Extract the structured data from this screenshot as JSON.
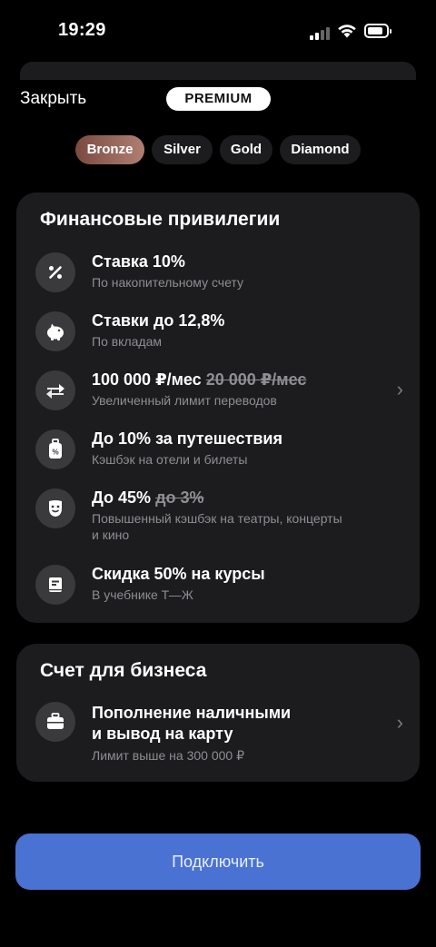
{
  "status": {
    "time": "19:29"
  },
  "header": {
    "close_label": "Закрыть",
    "badge": "PREMIUM"
  },
  "tiers": [
    "Bronze",
    "Silver",
    "Gold",
    "Diamond"
  ],
  "selected_tier": "Bronze",
  "financial": {
    "title": "Финансовые привилегии",
    "items": [
      {
        "title": "Ставка 10%",
        "subtitle": "По накопительному счету",
        "icon": "percent-icon"
      },
      {
        "title": "Ставки до 12,8%",
        "subtitle": "По вкладам",
        "icon": "piggy-bank-icon"
      },
      {
        "title": "100 000 ₽/мес",
        "strike": "20 000 ₽/мес",
        "subtitle": "Увеличенный лимит переводов",
        "icon": "transfer-arrows-icon"
      },
      {
        "title": "До 10% за путешествия",
        "subtitle": "Кэшбэк на отели и билеты",
        "icon": "luggage-icon"
      },
      {
        "title": "До 45%",
        "strike": "до 3%",
        "subtitle": "Повышенный кэшбэк на театры, концерты",
        "subtitle2": "и кино",
        "icon": "theater-mask-icon"
      },
      {
        "title": "Скидка 50% на курсы",
        "subtitle": "В учебнике Т—Ж",
        "icon": "book-icon"
      }
    ]
  },
  "business": {
    "title": "Счет для бизнеса",
    "item": {
      "title_line1": "Пополнение наличными",
      "title_line2": "и вывод на карту",
      "subtitle": "Лимит выше на 300 000 ₽",
      "icon": "briefcase-icon"
    }
  },
  "cta": {
    "label": "Подключить"
  },
  "colors": {
    "background": "#000000",
    "card": "#1c1c1e",
    "accent": "#4a72d3",
    "bronze": "#9a675c"
  }
}
